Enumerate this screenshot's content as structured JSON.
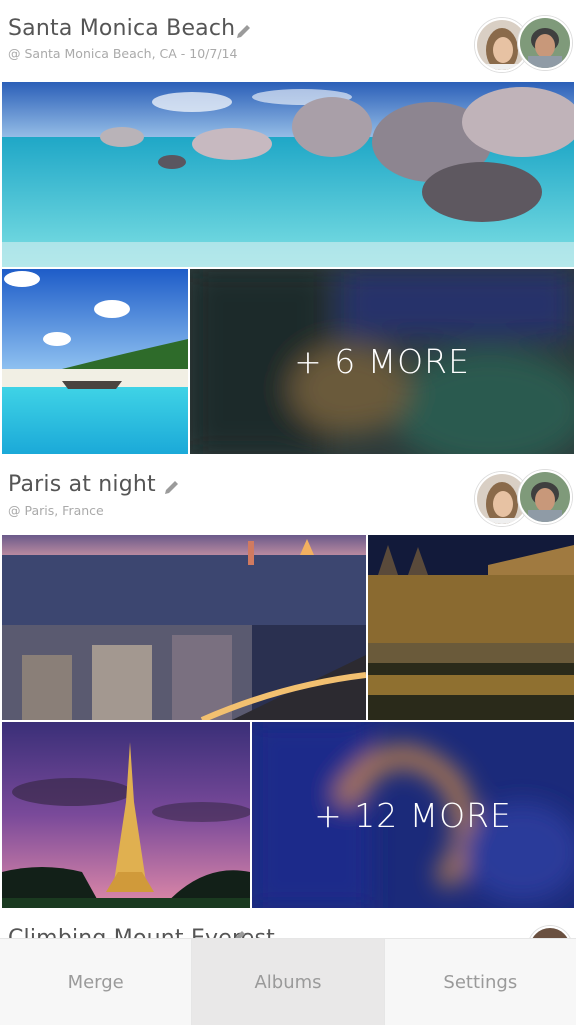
{
  "albums": [
    {
      "title": "Santa Monica Beach",
      "subtitle": "@ Santa Monica Beach, CA - 10/7/14",
      "more": "+ 6 MORE"
    },
    {
      "title": "Paris at night",
      "subtitle": "@ Paris, France",
      "more": "+ 12 MORE"
    },
    {
      "title": "Climbing Mount Everest"
    }
  ],
  "tabs": [
    {
      "label": "Merge"
    },
    {
      "label": "Albums"
    },
    {
      "label": "Settings"
    }
  ],
  "active_tab": "Albums",
  "colors": {
    "title_text": "#555555",
    "subtitle_text": "#aaaaaa",
    "tab_text": "#9a9a9a",
    "tab_bg": "#f7f7f7",
    "tab_active_bg": "#e9e8e8"
  }
}
